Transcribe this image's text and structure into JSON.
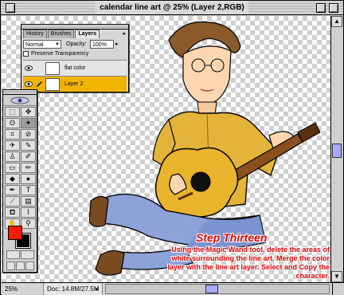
{
  "window": {
    "title": "calendar line art @ 25% (Layer 2,RGB)"
  },
  "layers_palette": {
    "tabs": [
      {
        "label": "History",
        "active": false
      },
      {
        "label": "Brushes",
        "active": false
      },
      {
        "label": "Layers",
        "active": true
      }
    ],
    "blend_mode": "Normal",
    "opacity_label": "Opacity:",
    "opacity_value": "100%",
    "preserve_transparency_label": "Preserve Transparency",
    "preserve_transparency_checked": false,
    "layers": [
      {
        "name": "flat color",
        "selected": false
      },
      {
        "name": "Layer 2",
        "selected": true
      }
    ],
    "selected_color": "#f0b400"
  },
  "toolbox": {
    "tools": [
      {
        "icon": "marquee-icon",
        "glyph": "⬚"
      },
      {
        "icon": "move-icon",
        "glyph": "✥"
      },
      {
        "icon": "lasso-icon",
        "glyph": "ʘ"
      },
      {
        "icon": "magic-wand-icon",
        "glyph": "✦"
      },
      {
        "icon": "crop-icon",
        "glyph": "⌗"
      },
      {
        "icon": "slice-icon",
        "glyph": "⊘"
      },
      {
        "icon": "airbrush-icon",
        "glyph": "✈"
      },
      {
        "icon": "paintbrush-icon",
        "glyph": "✎"
      },
      {
        "icon": "rubber-stamp-icon",
        "glyph": "♙"
      },
      {
        "icon": "history-brush-icon",
        "glyph": "✐"
      },
      {
        "icon": "eraser-icon",
        "glyph": "▭"
      },
      {
        "icon": "pencil-icon",
        "glyph": "✏"
      },
      {
        "icon": "blur-icon",
        "glyph": "◆"
      },
      {
        "icon": "dodge-icon",
        "glyph": "●"
      },
      {
        "icon": "pen-icon",
        "glyph": "✒"
      },
      {
        "icon": "type-icon",
        "glyph": "T"
      },
      {
        "icon": "measure-icon",
        "glyph": "⟋"
      },
      {
        "icon": "gradient-icon",
        "glyph": "▤"
      },
      {
        "icon": "paint-bucket-icon",
        "glyph": "⛾"
      },
      {
        "icon": "eyedropper-icon",
        "glyph": "⌇"
      },
      {
        "icon": "hand-icon",
        "glyph": "✋"
      },
      {
        "icon": "zoom-icon",
        "glyph": "⚲"
      }
    ],
    "foreground_color": "#ff1c00",
    "background_color": "#000000"
  },
  "status_bar": {
    "zoom": "25%",
    "doc_info": "Doc: 14.8M/27.5M"
  },
  "caption": {
    "title": "Step Thirteen",
    "body": "Using the Magic Wand tool, delete the areas of white surrounding the line art.  Merge the color layer with the line art layer.  Select and Copy the character.",
    "color": "#e10000"
  }
}
